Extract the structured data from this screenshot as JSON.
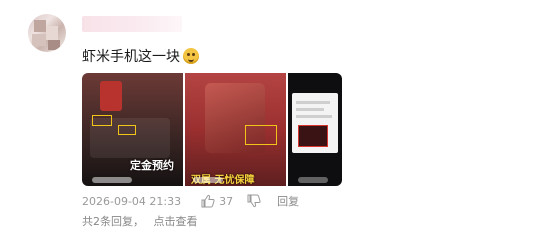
{
  "comment": {
    "text": "虾米手机这一块",
    "emoji": "grinning-face-emoji",
    "timestamp": "2026-09-04 21:33",
    "like_count": "37",
    "reply_label": "回复",
    "replies_summary": "共2条回复，",
    "view_label": "点击查看"
  },
  "thumbnails": [
    {
      "caption_white": "定金预约",
      "caption_yellow": "双属 无忧保障"
    },
    {},
    {}
  ],
  "colors": {
    "accent_highlight": "#f0c419",
    "meta_gray": "#9a9a9a"
  }
}
